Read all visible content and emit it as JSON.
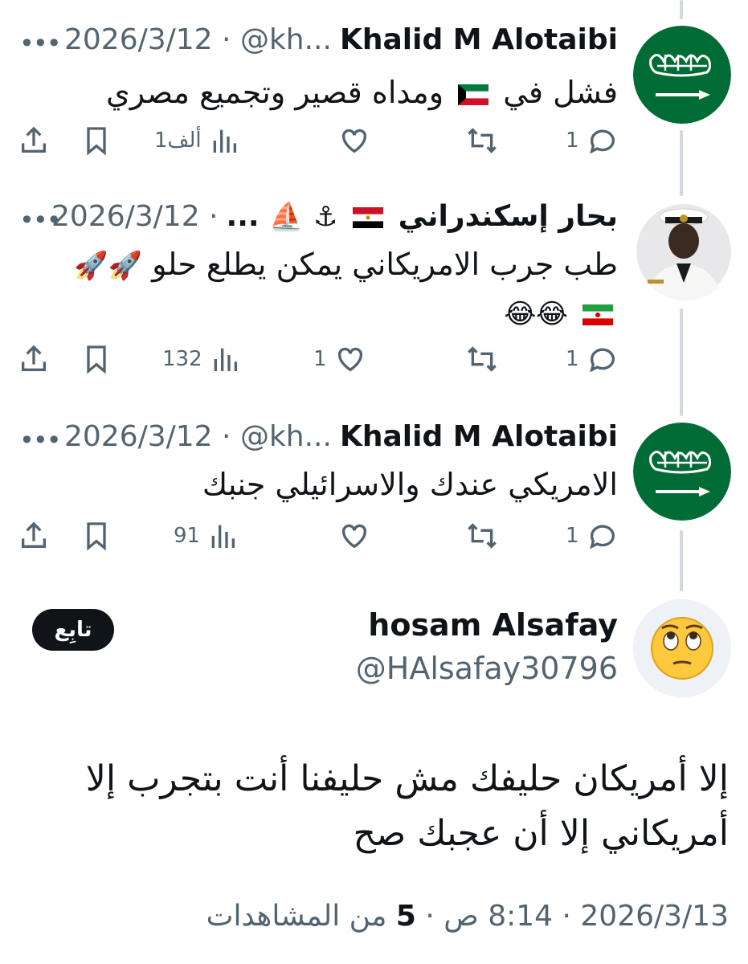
{
  "replies": [
    {
      "name": "Khalid M Alotaibi",
      "handle": "@kh...",
      "date": "2026/3/12",
      "text_before_flag": "فشل في",
      "text_after_flag": "ومداه قصير وتجميع مصري",
      "reply_count": "1",
      "retweet_count": "",
      "like_count": "",
      "views": "1ألف"
    },
    {
      "name": "بحار إسكندراني",
      "name_suffix": "...",
      "date": "2026/3/12",
      "text_line1": "طب جرب الامريكاني يمكن يطلع حلو",
      "reply_count": "1",
      "retweet_count": "",
      "like_count": "1",
      "views": "132"
    },
    {
      "name": "Khalid M Alotaibi",
      "handle": "@kh...",
      "date": "2026/3/12",
      "text": "الامريكي عندك والاسرائيلي جنبك",
      "reply_count": "1",
      "retweet_count": "",
      "like_count": "",
      "views": "91"
    }
  ],
  "main_tweet": {
    "name": "hosam Alsafay",
    "handle": "@HAlsafay30796",
    "follow_label": "تابِع",
    "text": "إلا أمريكان حليفك مش حليفنا أنت بتجرب إلا أمريكاني إلا أن عجبك صح",
    "date": "2026/3/13",
    "time": "8:14 ص",
    "views_count": "5",
    "views_label": "من المشاهدات"
  },
  "separator": "·",
  "icons": [
    "more-icon",
    "reply-icon",
    "retweet-icon",
    "like-icon",
    "views-icon",
    "bookmark-icon",
    "share-icon"
  ],
  "colors": {
    "text": "#0f1419",
    "secondary": "#536471",
    "thread_line": "#cfd9de",
    "saudi_green": "#006c35"
  }
}
